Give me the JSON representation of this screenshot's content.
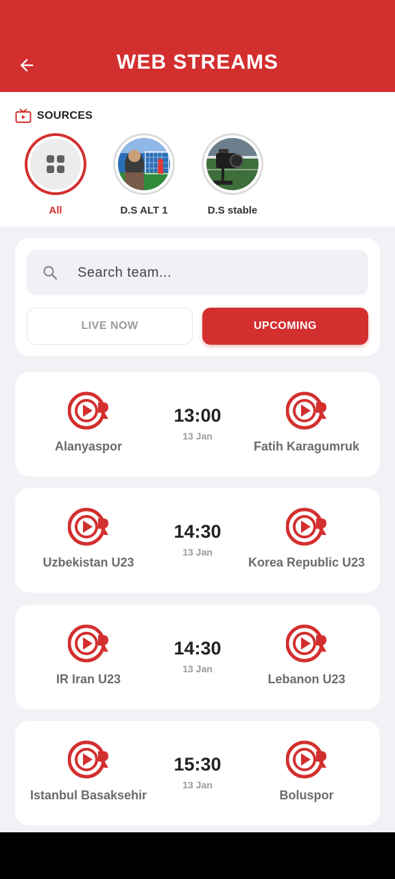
{
  "header": {
    "title": "WEB STREAMS",
    "back_icon": "arrow-left-icon",
    "color": "#d32f2f"
  },
  "sources": {
    "heading": "SOURCES",
    "heading_icon": "tv-icon",
    "items": [
      {
        "label": "All",
        "icon": "grid-icon",
        "active": true
      },
      {
        "label": "D.S ALT 1",
        "icon": "stadium-photo",
        "active": false
      },
      {
        "label": "D.S stable",
        "icon": "camera-photo",
        "active": false
      }
    ]
  },
  "search": {
    "placeholder": "Search team...",
    "value": "",
    "icon": "search-icon"
  },
  "tabs": [
    {
      "label": "LIVE NOW",
      "active": false
    },
    {
      "label": "UPCOMING",
      "active": true
    }
  ],
  "matches": [
    {
      "home": "Alanyaspor",
      "away": "Fatih Karagumruk",
      "time": "13:00",
      "date": "13 Jan"
    },
    {
      "home": "Uzbekistan U23",
      "away": "Korea Republic U23",
      "time": "14:30",
      "date": "13 Jan"
    },
    {
      "home": "IR Iran U23",
      "away": "Lebanon U23",
      "time": "14:30",
      "date": "13 Jan"
    },
    {
      "home": "Istanbul Basaksehir",
      "away": "Boluspor",
      "time": "15:30",
      "date": "13 Jan"
    }
  ]
}
